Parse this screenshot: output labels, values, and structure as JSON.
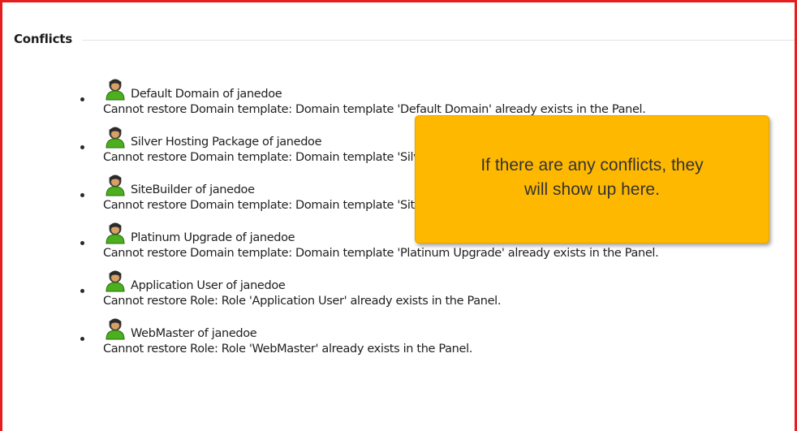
{
  "section": {
    "title": "Conflicts"
  },
  "conflicts": [
    {
      "icon": "user-icon",
      "name": "Default Domain of janedoe",
      "message": "Cannot restore Domain template: Domain template 'Default Domain' already exists in the Panel."
    },
    {
      "icon": "user-icon",
      "name": "Silver Hosting Package of janedoe",
      "message": "Cannot restore Domain template: Domain template 'Silver Hosting Package' already exists in the Panel."
    },
    {
      "icon": "user-icon",
      "name": "SiteBuilder of janedoe",
      "message": "Cannot restore Domain template: Domain template 'SiteBuilder' already exists in the Panel."
    },
    {
      "icon": "user-icon",
      "name": "Platinum Upgrade of janedoe",
      "message": "Cannot restore Domain template: Domain template 'Platinum Upgrade' already exists in the Panel."
    },
    {
      "icon": "user-icon",
      "name": "Application User of janedoe",
      "message": "Cannot restore Role: Role 'Application User' already exists in the Panel."
    },
    {
      "icon": "user-icon",
      "name": "WebMaster of janedoe",
      "message": "Cannot restore Role: Role 'WebMaster' already exists in the Panel."
    }
  ],
  "tooltip": {
    "text": "If there are any conflicts, they\nwill show up here."
  },
  "colors": {
    "frame_border": "#e41e1e",
    "tooltip_background": "#ffb800",
    "icon_green": "#4caf1e"
  }
}
